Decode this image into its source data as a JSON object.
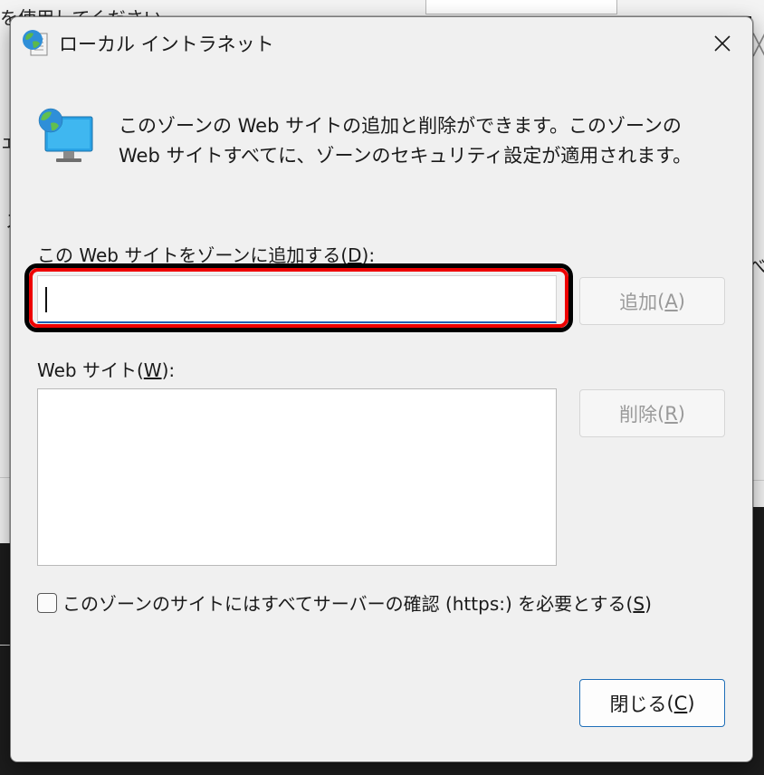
{
  "background": {
    "top_text": "を使用してください",
    "glyph_a": "ェ",
    "glyph_b": "ス",
    "right_text": "べて"
  },
  "dialog": {
    "title": "ローカル イントラネット",
    "description": "このゾーンの Web サイトの追加と削除ができます。このゾーンの Web サイトすべてに、ゾーンのセキュリティ設定が適用されます。",
    "add_label": "この Web サイトをゾーンに追加する",
    "add_label_key": "D",
    "add_input_value": "",
    "add_button_label": "追加",
    "add_button_key": "A",
    "sites_label": "Web サイト",
    "sites_label_key": "W",
    "sites": [],
    "remove_button_label": "削除",
    "remove_button_key": "R",
    "https_checkbox_label": "このゾーンのサイトにはすべてサーバーの確認 (https:) を必要とする",
    "https_checkbox_key": "S",
    "https_checked": false,
    "close_button_label": "閉じる",
    "close_button_key": "C"
  },
  "icons": {
    "title": "globe-intranet-icon",
    "intro": "intranet-monitor-icon",
    "close": "close-icon"
  },
  "colors": {
    "highlight": "#e00000",
    "focus_accent": "#1a5fb4",
    "primary_border": "#1f6fb8"
  }
}
